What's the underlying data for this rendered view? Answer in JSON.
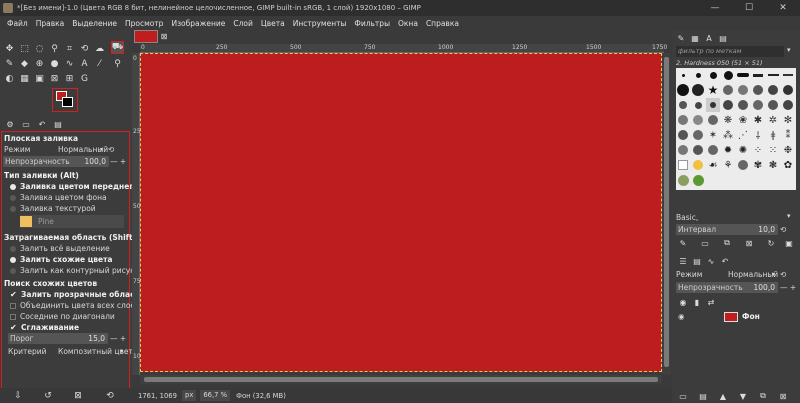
{
  "window": {
    "title": "*[Без имени]-1.0 (Цвета RGB 8 бит, нелинейное целочисленное, GIMP built-in sRGB, 1 слой) 1920x1080 – GIMP",
    "minimize": "—",
    "maximize": "☐",
    "close": "✕"
  },
  "menu": [
    "Файл",
    "Правка",
    "Выделение",
    "Просмотр",
    "Изображение",
    "Слой",
    "Цвета",
    "Инструменты",
    "Фильтры",
    "Окна",
    "Справка"
  ],
  "tool_options": {
    "title": "Плоская заливка",
    "mode_label": "Режим",
    "mode_value": "Нормальный",
    "opacity_label": "Непрозрачность",
    "opacity_value": "100,0",
    "fill_type_title": "Тип заливки (Alt)",
    "fill_fg": "Заливка цветом переднего плана",
    "fill_bg": "Заливка цветом фона",
    "fill_pattern": "Заливка текстурой",
    "pattern_name": "Pine",
    "area_title": "Затрагиваемая область (Shift)",
    "area_selection": "Залить всё выделение",
    "area_similar": "Залить схожие цвета",
    "area_lineart": "Залить как контурный рисунок",
    "similar_title": "Поиск схожих цветов",
    "fill_transparent": "Залить прозрачные области",
    "sample_merged": "Объединить цвета всех слоёв",
    "diagonal": "Соседние по диагонали",
    "antialias": "Сглаживание",
    "threshold_label": "Порог",
    "threshold_value": "15,0",
    "criterion_label": "Критерий",
    "criterion_value": "Композитный цвет"
  },
  "ruler": {
    "h_labels": [
      "0",
      "250",
      "500",
      "750",
      "1000",
      "1250",
      "1500",
      "1750"
    ],
    "v_labels": [
      "0",
      "250",
      "500",
      "750",
      "1000"
    ]
  },
  "status": {
    "coords": "1761, 1069",
    "unit": "px",
    "zoom": "66,7 %",
    "info": "Фон (32,6 MB)"
  },
  "right_panel": {
    "filter_placeholder": "фильтр по меткам",
    "brush_name": "2. Hardness 050 (51 × 51)",
    "brush_preset": "Basic,",
    "interval_label": "Интервал",
    "interval_value": "10,0",
    "layer_mode_label": "Режим",
    "layer_mode_value": "Нормальный",
    "layer_opacity_label": "Непрозрачность",
    "layer_opacity_value": "100,0",
    "layer_name": "Фон"
  },
  "colors": {
    "foreground": "#c01e1e",
    "background": "#000000",
    "canvas": "#bd1d1f",
    "highlight": "#d02020"
  }
}
